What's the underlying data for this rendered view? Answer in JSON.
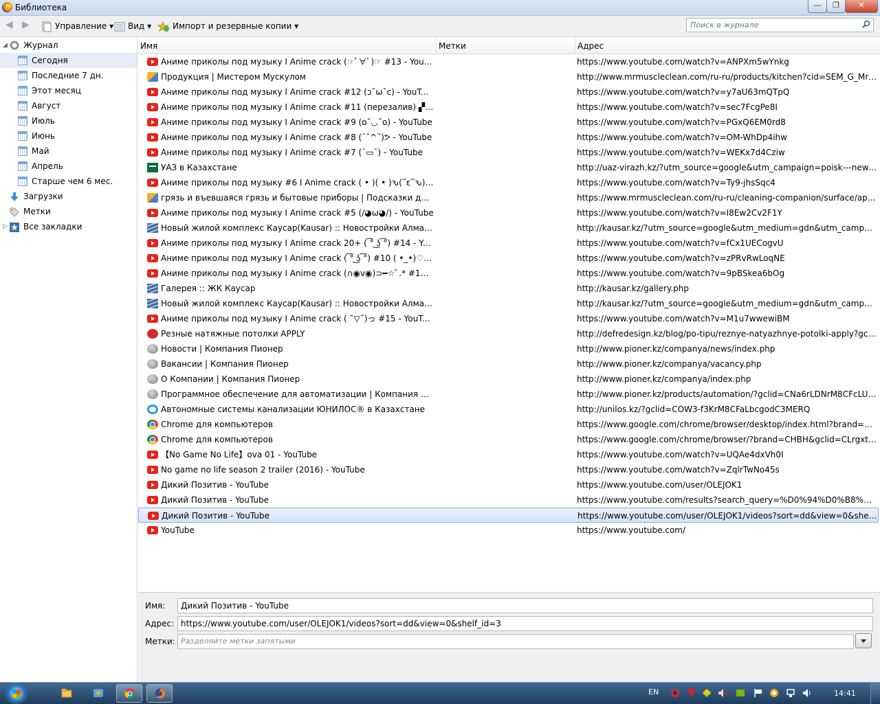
{
  "window": {
    "title": "Библиотека"
  },
  "toolbar": {
    "organize_label": "Управление",
    "views_label": "Вид",
    "import_label": "Импорт и резервные копии",
    "search_placeholder": "Поиск в журнале"
  },
  "sidebar": {
    "items": [
      {
        "label": "Журнал",
        "icon": "history-clock-icon",
        "level": 0,
        "expanded": true
      },
      {
        "label": "Сегодня",
        "icon": "calendar-icon",
        "level": 1,
        "selected": true
      },
      {
        "label": "Последние 7 дн.",
        "icon": "calendar-icon",
        "level": 1
      },
      {
        "label": "Этот месяц",
        "icon": "calendar-icon",
        "level": 1
      },
      {
        "label": "Август",
        "icon": "calendar-icon",
        "level": 1
      },
      {
        "label": "Июль",
        "icon": "calendar-icon",
        "level": 1
      },
      {
        "label": "Июнь",
        "icon": "calendar-icon",
        "level": 1
      },
      {
        "label": "Май",
        "icon": "calendar-icon",
        "level": 1
      },
      {
        "label": "Апрель",
        "icon": "calendar-icon",
        "level": 1
      },
      {
        "label": "Старше чем 6 мес.",
        "icon": "calendar-icon",
        "level": 1
      },
      {
        "label": "Загрузки",
        "icon": "downloads-arrow-icon",
        "level": 0
      },
      {
        "label": "Метки",
        "icon": "tag-icon",
        "level": 0
      },
      {
        "label": "Все закладки",
        "icon": "bookmarks-star-icon",
        "level": 0,
        "collapsed": true
      }
    ]
  },
  "columns": {
    "name": "Имя",
    "tags": "Метки",
    "address": "Адрес"
  },
  "rows": [
    {
      "favicon": "youtube",
      "name": "Аниме приколы под музыку I Anime crack (☞ﾟ∀ﾟ)☞ #13 - YouTube",
      "address": "https://www.youtube.com/watch?v=ANPXm5wYnkg"
    },
    {
      "favicon": "mrmuscle",
      "name": "Продукция | Мистером Мускулом",
      "address": "http://www.mrmuscleclean.com/ru-ru/products/kitchen?cid=SEM_G_MrMuscle..."
    },
    {
      "favicon": "youtube",
      "name": "Аниме приколы под музыку I Anime crack #12 (ɔ˘ω˘c) - YouTube",
      "address": "https://www.youtube.com/watch?v=y7aU63mQTpQ"
    },
    {
      "favicon": "youtube",
      "name": "Аниме приколы под музыку I Anime crack #11 (перезалив) ▞▚▟ - YouTube",
      "address": "https://www.youtube.com/watch?v=sec7FcgPe8I"
    },
    {
      "favicon": "youtube",
      "name": "Аниме приколы под музыку I Anime crack #9 (o˘◡˘o) - YouTube",
      "address": "https://www.youtube.com/watch?v=PGxQ6EM0rd8"
    },
    {
      "favicon": "youtube",
      "name": "Аниме приколы под музыку I Anime crack #8 (¯˘^˘)ᕗ - YouTube",
      "address": "https://www.youtube.com/watch?v=OM-WhDp4ihw"
    },
    {
      "favicon": "youtube",
      "name": "Аниме приколы под музыку I Anime crack #7 (¯▭¯) - YouTube",
      "address": "https://www.youtube.com/watch?v=WEKx7d4Cziw"
    },
    {
      "favicon": "uaz",
      "name": "УАЗ в Казахстане",
      "address": "http://uaz-virazh.kz/?utm_source=google&utm_campaign=poisk---new&utm_..."
    },
    {
      "favicon": "youtube",
      "name": "Аниме приколы под музыку #6 I Anime crack ( • )( • )ԅ(‾ε‾ԅ) 18+ - YouTube",
      "address": "https://www.youtube.com/watch?v=Ty9-jhsSqc4"
    },
    {
      "favicon": "mrmuscle",
      "name": "грязь и въевшаяся грязь и бытовые приборы | Подсказки для уборки",
      "address": "https://www.mrmuscleclean.com/ru-ru/cleaning-companion/surface/appliances..."
    },
    {
      "favicon": "youtube",
      "name": "Аниме приколы под музыку I Anime crack #5 (/◕ω◕/) - YouTube",
      "address": "https://www.youtube.com/watch?v=I8Ew2Cv2F1Y"
    },
    {
      "favicon": "kausar",
      "name": "Новый жилой комплекс Каусар(Kausar) :: Новостройки Алматы :: ЖК Каусар",
      "address": "http://kausar.kz/?utm_source=google&utm_medium=gdn&utm_campaign=kau..."
    },
    {
      "favicon": "youtube",
      "name": "Аниме приколы под музыку I Anime crack 20+ ( ͡° ͜ʖ ͡°) #14 - YouTube",
      "address": "https://www.youtube.com/watch?v=fCx1UECogvU"
    },
    {
      "favicon": "youtube",
      "name": "Аниме приколы под музыку I Anime crack ( ͡° ͜ʖ ͡°) #10 ( •_•)♡ - YouTube",
      "address": "https://www.youtube.com/watch?v=zPRvRwLoqNE"
    },
    {
      "favicon": "youtube",
      "name": "Аниме приколы под музыку I Anime crack (∩◉v◉)⊃━☆ﾟ.* #16 - YouTube",
      "address": "https://www.youtube.com/watch?v=9pBSkea6bOg"
    },
    {
      "favicon": "kausar",
      "name": "Галерея :: ЖК Каусар",
      "address": "http://kausar.kz/gallery.php"
    },
    {
      "favicon": "kausar",
      "name": "Новый жилой комплекс Каусар(Kausar) :: Новостройки Алматы :: ЖК Каусар",
      "address": "http://kausar.kz/?utm_source=google&utm_medium=gdn&utm_campaign=kau..."
    },
    {
      "favicon": "youtube",
      "name": "Аниме приколы под музыку I Anime crack ( ˘▽˘)っ #15 - YouTube",
      "address": "https://www.youtube.com/watch?v=M1u7wwewiBM"
    },
    {
      "favicon": "apply",
      "name": "Резные натяжные потолки APPLY",
      "address": "http://defredesign.kz/blog/po-tipu/reznye-natyazhnye-potolki-apply?gclid=CNT..."
    },
    {
      "favicon": "globe",
      "name": "Новости | Компания Пионер",
      "address": "http://www.pioner.kz/companya/news/index.php"
    },
    {
      "favicon": "globe",
      "name": "Вакансии | Компания Пионер",
      "address": "http://www.pioner.kz/companya/vacancy.php"
    },
    {
      "favicon": "globe",
      "name": "О Компании | Компания Пионер",
      "address": "http://www.pioner.kz/companya/index.php"
    },
    {
      "favicon": "globe",
      "name": "Программное обеспечение для автоматизации | Компания Пионер",
      "address": "http://www.pioner.kz/products/automation/?gclid=CNa6rLDNrM8CFcLUcgodN-..."
    },
    {
      "favicon": "unilos",
      "name": "Автономные системы канализации ЮНИЛОС® в Казахстане",
      "address": "http://unilos.kz/?gclid=COW3-f3KrM8CFaLbcgodC3MERQ"
    },
    {
      "favicon": "chrome",
      "name": "Chrome для компьютеров",
      "address": "https://www.google.com/chrome/browser/desktop/index.html?brand=CHBH&gcli..."
    },
    {
      "favicon": "chrome",
      "name": "Chrome для компьютеров",
      "address": "https://www.google.com/chrome/browser/?brand=CHBH&gclid=CLrgxtDKrM8..."
    },
    {
      "favicon": "youtube",
      "name": "【No Game No Life】ova 01 - YouTube",
      "address": "https://www.youtube.com/watch?v=UQAe4dxVh0I"
    },
    {
      "favicon": "youtube",
      "name": "No game no life season 2 trailer (2016) - YouTube",
      "address": "https://www.youtube.com/watch?v=ZqlrTwNo45s"
    },
    {
      "favicon": "youtube",
      "name": "Дикий Позитив - YouTube",
      "address": "https://www.youtube.com/user/OLEJOK1"
    },
    {
      "favicon": "youtube",
      "name": "Дикий Позитив - YouTube",
      "address": "https://www.youtube.com/results?search_query=%D0%94%D0%B8%D0%BA%D0..."
    },
    {
      "favicon": "youtube",
      "name": "Дикий Позитив - YouTube",
      "address": "https://www.youtube.com/user/OLEJOK1/videos?sort=dd&view=0&shelf_id=3",
      "selected": true
    },
    {
      "favicon": "youtube",
      "name": "YouTube",
      "address": "https://www.youtube.com/"
    }
  ],
  "details": {
    "name_label": "Имя:",
    "name_value": "Дикий Позитив - YouTube",
    "address_label": "Адрес:",
    "address_value": "https://www.youtube.com/user/OLEJOK1/videos?sort=dd&view=0&shelf_id=3",
    "tags_label": "Метки:",
    "tags_placeholder": "Разделяйте метки запятыми"
  },
  "taskbar": {
    "language": "EN",
    "clock": "14:41"
  }
}
